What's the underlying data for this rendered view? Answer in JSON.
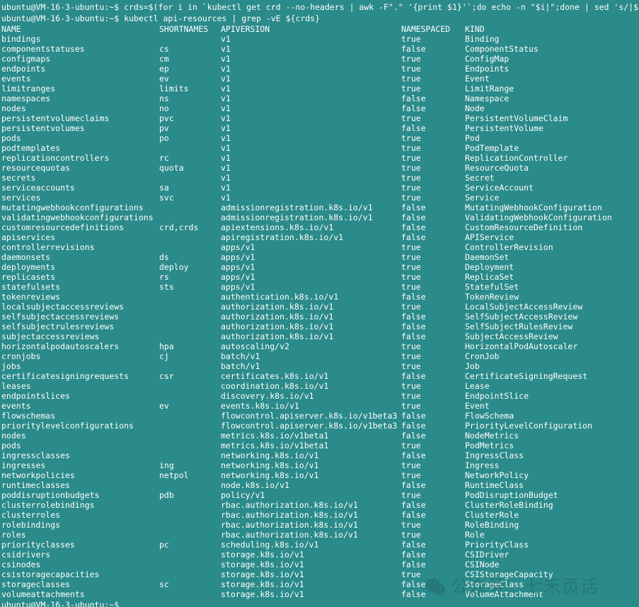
{
  "terminal": {
    "prompt": "ubuntu@VM-16-3-ubuntu:~$",
    "command_1": "ubuntu@VM-16-3-ubuntu:~$ crds=$(for i in `kubectl get crd --no-headers | awk -F\".\" '{print $1}'`;do echo -n \"$i|\";done | sed 's/|$//g')",
    "command_2": "ubuntu@VM-16-3-ubuntu:~$ kubectl api-resources | grep -vE ${crds}",
    "final_prompt": "ubuntu@VM-16-3-ubuntu:~$",
    "background_color": "#2b8a8a",
    "text_color": "#ffffff"
  },
  "table": {
    "headers": {
      "name": "NAME",
      "shortnames": "SHORTNAMES",
      "apiversion": "APIVERSION",
      "namespaced": "NAMESPACED",
      "kind": "KIND"
    },
    "rows": [
      {
        "name": "bindings",
        "shortnames": "",
        "apiversion": "v1",
        "namespaced": "true",
        "kind": "Binding"
      },
      {
        "name": "componentstatuses",
        "shortnames": "cs",
        "apiversion": "v1",
        "namespaced": "false",
        "kind": "ComponentStatus"
      },
      {
        "name": "configmaps",
        "shortnames": "cm",
        "apiversion": "v1",
        "namespaced": "true",
        "kind": "ConfigMap"
      },
      {
        "name": "endpoints",
        "shortnames": "ep",
        "apiversion": "v1",
        "namespaced": "true",
        "kind": "Endpoints"
      },
      {
        "name": "events",
        "shortnames": "ev",
        "apiversion": "v1",
        "namespaced": "true",
        "kind": "Event"
      },
      {
        "name": "limitranges",
        "shortnames": "limits",
        "apiversion": "v1",
        "namespaced": "true",
        "kind": "LimitRange"
      },
      {
        "name": "namespaces",
        "shortnames": "ns",
        "apiversion": "v1",
        "namespaced": "false",
        "kind": "Namespace"
      },
      {
        "name": "nodes",
        "shortnames": "no",
        "apiversion": "v1",
        "namespaced": "false",
        "kind": "Node"
      },
      {
        "name": "persistentvolumeclaims",
        "shortnames": "pvc",
        "apiversion": "v1",
        "namespaced": "true",
        "kind": "PersistentVolumeClaim"
      },
      {
        "name": "persistentvolumes",
        "shortnames": "pv",
        "apiversion": "v1",
        "namespaced": "false",
        "kind": "PersistentVolume"
      },
      {
        "name": "pods",
        "shortnames": "po",
        "apiversion": "v1",
        "namespaced": "true",
        "kind": "Pod"
      },
      {
        "name": "podtemplates",
        "shortnames": "",
        "apiversion": "v1",
        "namespaced": "true",
        "kind": "PodTemplate"
      },
      {
        "name": "replicationcontrollers",
        "shortnames": "rc",
        "apiversion": "v1",
        "namespaced": "true",
        "kind": "ReplicationController"
      },
      {
        "name": "resourcequotas",
        "shortnames": "quota",
        "apiversion": "v1",
        "namespaced": "true",
        "kind": "ResourceQuota"
      },
      {
        "name": "secrets",
        "shortnames": "",
        "apiversion": "v1",
        "namespaced": "true",
        "kind": "Secret"
      },
      {
        "name": "serviceaccounts",
        "shortnames": "sa",
        "apiversion": "v1",
        "namespaced": "true",
        "kind": "ServiceAccount"
      },
      {
        "name": "services",
        "shortnames": "svc",
        "apiversion": "v1",
        "namespaced": "true",
        "kind": "Service"
      },
      {
        "name": "mutatingwebhookconfigurations",
        "shortnames": "",
        "apiversion": "admissionregistration.k8s.io/v1",
        "namespaced": "false",
        "kind": "MutatingWebhookConfiguration"
      },
      {
        "name": "validatingwebhookconfigurations",
        "shortnames": "",
        "apiversion": "admissionregistration.k8s.io/v1",
        "namespaced": "false",
        "kind": "ValidatingWebhookConfiguration"
      },
      {
        "name": "customresourcedefinitions",
        "shortnames": "crd,crds",
        "apiversion": "apiextensions.k8s.io/v1",
        "namespaced": "false",
        "kind": "CustomResourceDefinition"
      },
      {
        "name": "apiservices",
        "shortnames": "",
        "apiversion": "apiregistration.k8s.io/v1",
        "namespaced": "false",
        "kind": "APIService"
      },
      {
        "name": "controllerrevisions",
        "shortnames": "",
        "apiversion": "apps/v1",
        "namespaced": "true",
        "kind": "ControllerRevision"
      },
      {
        "name": "daemonsets",
        "shortnames": "ds",
        "apiversion": "apps/v1",
        "namespaced": "true",
        "kind": "DaemonSet"
      },
      {
        "name": "deployments",
        "shortnames": "deploy",
        "apiversion": "apps/v1",
        "namespaced": "true",
        "kind": "Deployment"
      },
      {
        "name": "replicasets",
        "shortnames": "rs",
        "apiversion": "apps/v1",
        "namespaced": "true",
        "kind": "ReplicaSet"
      },
      {
        "name": "statefulsets",
        "shortnames": "sts",
        "apiversion": "apps/v1",
        "namespaced": "true",
        "kind": "StatefulSet"
      },
      {
        "name": "tokenreviews",
        "shortnames": "",
        "apiversion": "authentication.k8s.io/v1",
        "namespaced": "false",
        "kind": "TokenReview"
      },
      {
        "name": "localsubjectaccessreviews",
        "shortnames": "",
        "apiversion": "authorization.k8s.io/v1",
        "namespaced": "true",
        "kind": "LocalSubjectAccessReview"
      },
      {
        "name": "selfsubjectaccessreviews",
        "shortnames": "",
        "apiversion": "authorization.k8s.io/v1",
        "namespaced": "false",
        "kind": "SelfSubjectAccessReview"
      },
      {
        "name": "selfsubjectrulesreviews",
        "shortnames": "",
        "apiversion": "authorization.k8s.io/v1",
        "namespaced": "false",
        "kind": "SelfSubjectRulesReview"
      },
      {
        "name": "subjectaccessreviews",
        "shortnames": "",
        "apiversion": "authorization.k8s.io/v1",
        "namespaced": "false",
        "kind": "SubjectAccessReview"
      },
      {
        "name": "horizontalpodautoscalers",
        "shortnames": "hpa",
        "apiversion": "autoscaling/v2",
        "namespaced": "true",
        "kind": "HorizontalPodAutoscaler"
      },
      {
        "name": "cronjobs",
        "shortnames": "cj",
        "apiversion": "batch/v1",
        "namespaced": "true",
        "kind": "CronJob"
      },
      {
        "name": "jobs",
        "shortnames": "",
        "apiversion": "batch/v1",
        "namespaced": "true",
        "kind": "Job"
      },
      {
        "name": "certificatesigningrequests",
        "shortnames": "csr",
        "apiversion": "certificates.k8s.io/v1",
        "namespaced": "false",
        "kind": "CertificateSigningRequest"
      },
      {
        "name": "leases",
        "shortnames": "",
        "apiversion": "coordination.k8s.io/v1",
        "namespaced": "true",
        "kind": "Lease"
      },
      {
        "name": "endpointslices",
        "shortnames": "",
        "apiversion": "discovery.k8s.io/v1",
        "namespaced": "true",
        "kind": "EndpointSlice"
      },
      {
        "name": "events",
        "shortnames": "ev",
        "apiversion": "events.k8s.io/v1",
        "namespaced": "true",
        "kind": "Event"
      },
      {
        "name": "flowschemas",
        "shortnames": "",
        "apiversion": "flowcontrol.apiserver.k8s.io/v1beta3",
        "namespaced": "false",
        "kind": "FlowSchema"
      },
      {
        "name": "prioritylevelconfigurations",
        "shortnames": "",
        "apiversion": "flowcontrol.apiserver.k8s.io/v1beta3",
        "namespaced": "false",
        "kind": "PriorityLevelConfiguration"
      },
      {
        "name": "nodes",
        "shortnames": "",
        "apiversion": "metrics.k8s.io/v1beta1",
        "namespaced": "false",
        "kind": "NodeMetrics"
      },
      {
        "name": "pods",
        "shortnames": "",
        "apiversion": "metrics.k8s.io/v1beta1",
        "namespaced": "true",
        "kind": "PodMetrics"
      },
      {
        "name": "ingressclasses",
        "shortnames": "",
        "apiversion": "networking.k8s.io/v1",
        "namespaced": "false",
        "kind": "IngressClass"
      },
      {
        "name": "ingresses",
        "shortnames": "ing",
        "apiversion": "networking.k8s.io/v1",
        "namespaced": "true",
        "kind": "Ingress"
      },
      {
        "name": "networkpolicies",
        "shortnames": "netpol",
        "apiversion": "networking.k8s.io/v1",
        "namespaced": "true",
        "kind": "NetworkPolicy"
      },
      {
        "name": "runtimeclasses",
        "shortnames": "",
        "apiversion": "node.k8s.io/v1",
        "namespaced": "false",
        "kind": "RuntimeClass"
      },
      {
        "name": "poddisruptionbudgets",
        "shortnames": "pdb",
        "apiversion": "policy/v1",
        "namespaced": "true",
        "kind": "PodDisruptionBudget"
      },
      {
        "name": "clusterrolebindings",
        "shortnames": "",
        "apiversion": "rbac.authorization.k8s.io/v1",
        "namespaced": "false",
        "kind": "ClusterRoleBinding"
      },
      {
        "name": "clusterroles",
        "shortnames": "",
        "apiversion": "rbac.authorization.k8s.io/v1",
        "namespaced": "false",
        "kind": "ClusterRole"
      },
      {
        "name": "rolebindings",
        "shortnames": "",
        "apiversion": "rbac.authorization.k8s.io/v1",
        "namespaced": "true",
        "kind": "RoleBinding"
      },
      {
        "name": "roles",
        "shortnames": "",
        "apiversion": "rbac.authorization.k8s.io/v1",
        "namespaced": "true",
        "kind": "Role"
      },
      {
        "name": "priorityclasses",
        "shortnames": "pc",
        "apiversion": "scheduling.k8s.io/v1",
        "namespaced": "false",
        "kind": "PriorityClass"
      },
      {
        "name": "csidrivers",
        "shortnames": "",
        "apiversion": "storage.k8s.io/v1",
        "namespaced": "false",
        "kind": "CSIDriver"
      },
      {
        "name": "csinodes",
        "shortnames": "",
        "apiversion": "storage.k8s.io/v1",
        "namespaced": "false",
        "kind": "CSINode"
      },
      {
        "name": "csistoragecapacities",
        "shortnames": "",
        "apiversion": "storage.k8s.io/v1",
        "namespaced": "true",
        "kind": "CSIStorageCapacity"
      },
      {
        "name": "storageclasses",
        "shortnames": "sc",
        "apiversion": "storage.k8s.io/v1",
        "namespaced": "false",
        "kind": "StorageClass"
      },
      {
        "name": "volumeattachments",
        "shortnames": "",
        "apiversion": "storage.k8s.io/v1",
        "namespaced": "false",
        "kind": "VolumeAttachment"
      }
    ]
  },
  "watermark": {
    "text": "公众号 · 七禾页话",
    "icon": "wechat-icon",
    "color": "#1d4f4f"
  }
}
